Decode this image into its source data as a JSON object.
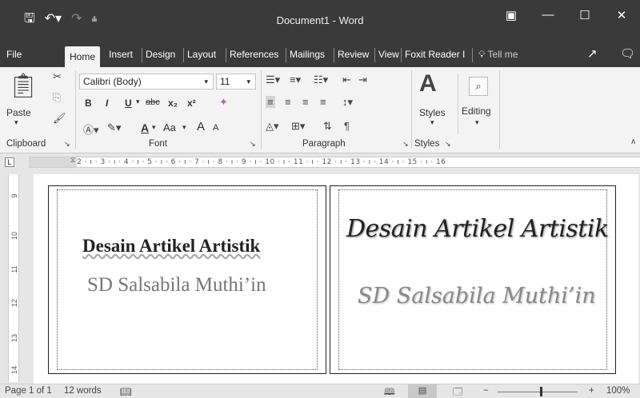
{
  "titlebar": {
    "title": "Document1 - Word",
    "save_icon": "save-icon",
    "undo_icon": "undo-icon",
    "redo_icon": "redo-icon",
    "ribbon_display_icon": "ribbon-display-icon",
    "minimize_icon": "minimize-icon",
    "maximize_icon": "maximize-icon",
    "close_icon": "close-icon"
  },
  "tabs": [
    "File",
    "Home",
    "Insert",
    "Design",
    "Layout",
    "References",
    "Mailings",
    "Review",
    "View",
    "Foxit Reader I"
  ],
  "tell_me": "Tell me",
  "clipboard": {
    "paste": "Paste",
    "label": "Clipboard"
  },
  "font": {
    "name": "Calibri (Body)",
    "size": "11",
    "label": "Font",
    "bold": "B",
    "italic": "I",
    "underline": "U",
    "strike": "abc",
    "sub": "x₂",
    "sup": "x²",
    "case": "Aa",
    "grow": "A",
    "shrink": "A",
    "color": "A"
  },
  "paragraph": {
    "label": "Paragraph"
  },
  "styles": {
    "button": "Styles",
    "label": "Styles"
  },
  "editing": {
    "button": "Editing"
  },
  "ruler": {
    "text": "· 1 · ı · 2 · ı · 3 · ı · 4 · ı · 5 · ı · 6 · ı · 7 · ı · 8 · ı · 9 · ı · 10 · ı · 11 · ı · 12 · ı · 13 · ı · 14 · ı · 15 · ı · 16"
  },
  "vruler": [
    "9",
    "10",
    "11",
    "12",
    "13",
    "14"
  ],
  "document": {
    "left_title": "Desain Artikel Artistik",
    "left_subtitle": "SD Salsabila Muthi’in",
    "right_title": "Desain Artikel Artistik",
    "right_subtitle": "SD Salsabila Muthi’in"
  },
  "status": {
    "page": "Page 1 of 1",
    "words": "12 words",
    "zoom": "100%",
    "zoom_percent": 100
  }
}
